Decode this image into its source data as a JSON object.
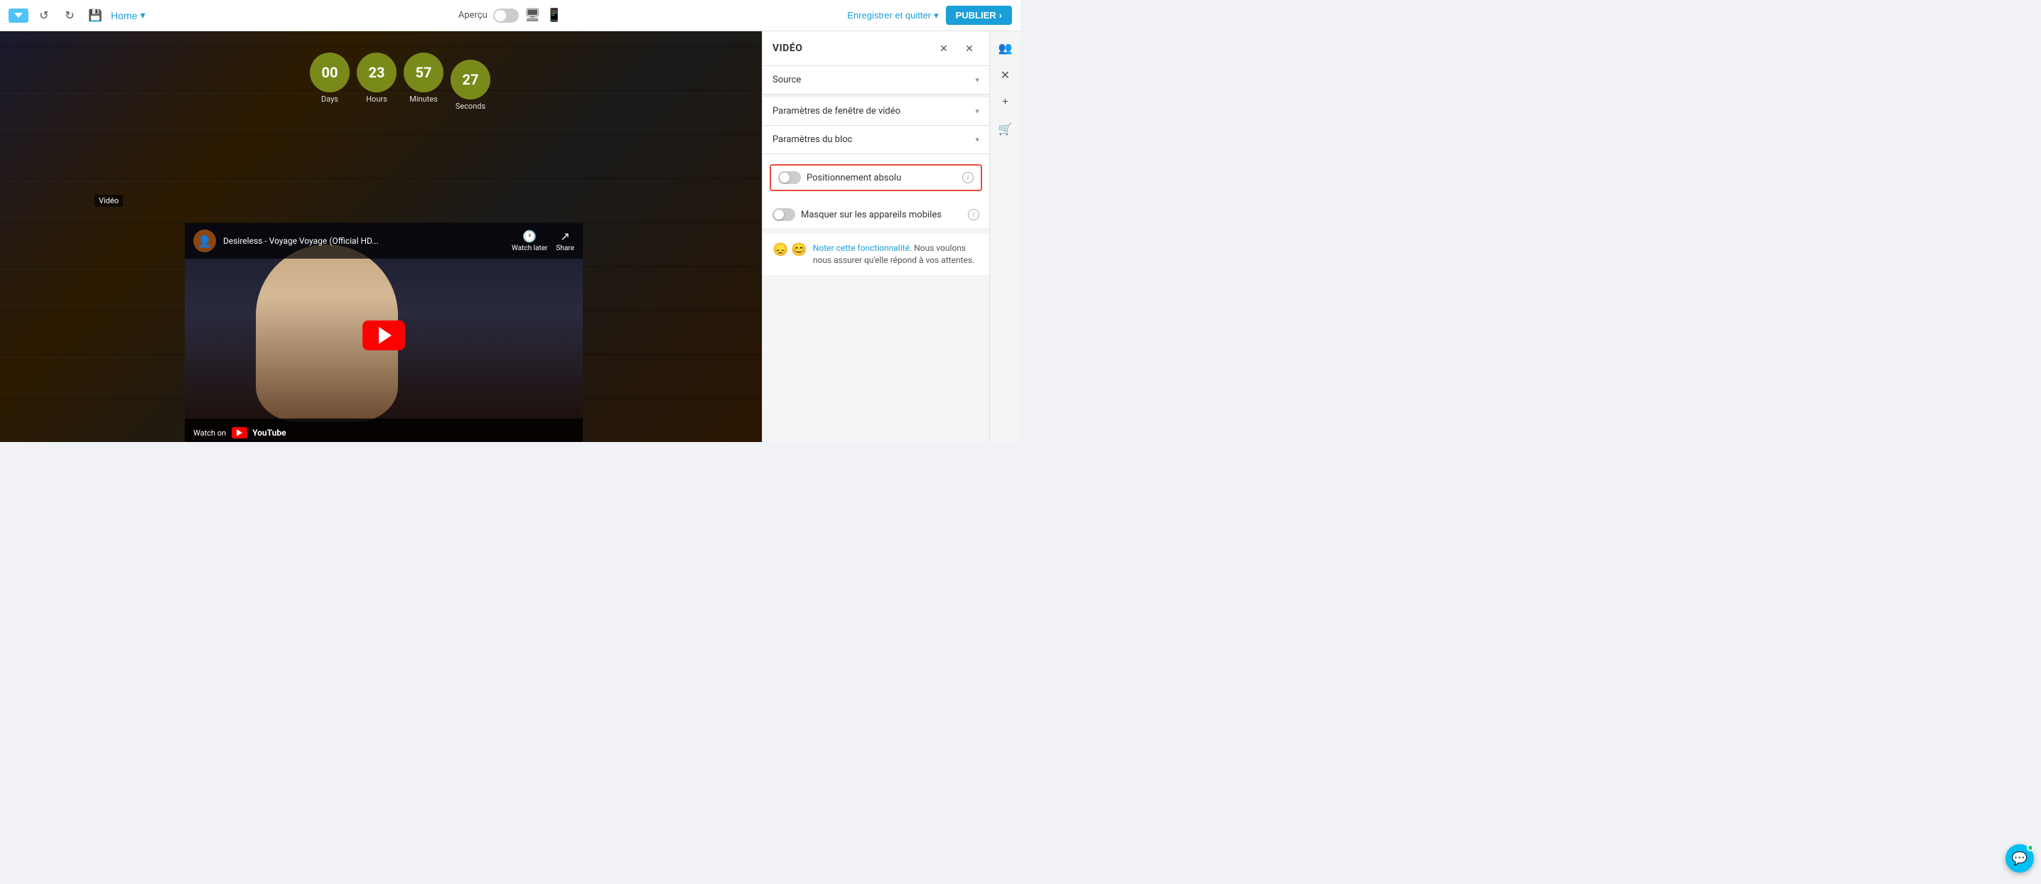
{
  "toolbar": {
    "home_label": "Home",
    "apercu_label": "Aperçu",
    "enregistrer_label": "Enregistrer et quitter",
    "publier_label": "PUBLIER"
  },
  "panel": {
    "title": "VIDÉO",
    "source_label": "Source",
    "params_fenetre_label": "Paramètres de fenêtre de vidéo",
    "params_bloc_label": "Paramètres du bloc",
    "positionnement_label": "Positionnement absolu",
    "masquer_label": "Masquer sur les appareils mobiles",
    "rating_link": "Noter cette fonctionnalité",
    "rating_text": ". Nous voulons nous assurer qu'elle répond à vos attentes."
  },
  "countdown": {
    "days_value": "00",
    "days_label": "Days",
    "hours_value": "23",
    "hours_label": "Hours",
    "minutes_value": "57",
    "minutes_label": "Minutes",
    "seconds_value": "27",
    "seconds_label": "Seconds"
  },
  "youtube": {
    "title": "Desireless - Voyage Voyage (Official HD...",
    "watch_later_label": "Watch later",
    "share_label": "Share",
    "watch_on_label": "Watch on",
    "youtube_label": "YouTube"
  },
  "video_tag": "Vidéo"
}
